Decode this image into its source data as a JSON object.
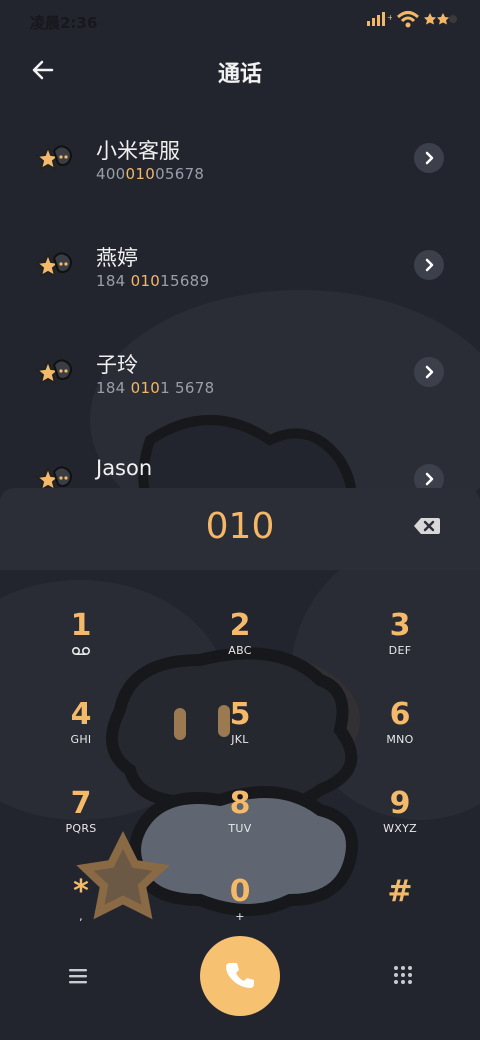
{
  "status_bar": {
    "time": "凌晨2:36"
  },
  "header": {
    "title": "通话"
  },
  "contacts": [
    {
      "name": "小米客服",
      "number_pre": "400",
      "number_hl": "010",
      "number_post": "05678"
    },
    {
      "name": "燕婷",
      "number_pre": "184 ",
      "number_hl": "010",
      "number_post": "15689"
    },
    {
      "name": "子玲",
      "number_pre": "184 ",
      "number_hl": "010",
      "number_post": "1 5678"
    },
    {
      "name": "Jason",
      "number_pre": "",
      "number_hl": "",
      "number_post": ""
    }
  ],
  "dialer": {
    "input": "010"
  },
  "keypad": [
    {
      "digit": "1",
      "letters": ""
    },
    {
      "digit": "2",
      "letters": "ABC"
    },
    {
      "digit": "3",
      "letters": "DEF"
    },
    {
      "digit": "4",
      "letters": "GHI"
    },
    {
      "digit": "5",
      "letters": "JKL"
    },
    {
      "digit": "6",
      "letters": "MNO"
    },
    {
      "digit": "7",
      "letters": "PQRS"
    },
    {
      "digit": "8",
      "letters": "TUV"
    },
    {
      "digit": "9",
      "letters": "WXYZ"
    },
    {
      "digit": "*",
      "letters": ","
    },
    {
      "digit": "0",
      "letters": "+"
    },
    {
      "digit": "#",
      "letters": ""
    }
  ],
  "colors": {
    "accent": "#f3b766",
    "call_button": "#f7c172",
    "background": "#232630",
    "panel": "#2b2e37"
  },
  "icons": {
    "back": "arrow-left-icon",
    "arrow": "chevron-right-icon",
    "backspace": "backspace-icon",
    "menu": "menu-icon",
    "call": "phone-icon",
    "dialpad": "dialpad-icon",
    "voicemail": "voicemail-icon"
  }
}
